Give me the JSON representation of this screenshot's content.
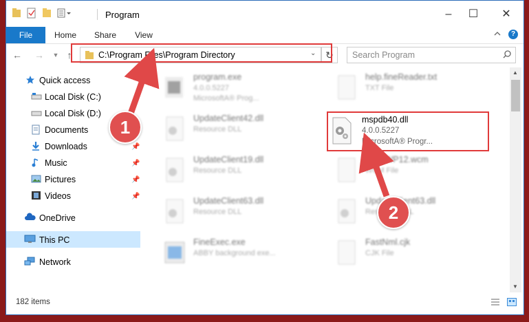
{
  "window": {
    "title": "Program"
  },
  "ribbon": {
    "tabs": [
      "File",
      "Home",
      "Share",
      "View"
    ],
    "help": "?"
  },
  "nav": {
    "path": "C:\\Program Files\\Program Directory",
    "search_placeholder": "Search Program"
  },
  "sidebar": {
    "items": [
      {
        "label": "Quick access",
        "icon": "star-icon"
      },
      {
        "label": "Local Disk (C:)",
        "icon": "drive-icon"
      },
      {
        "label": "Local Disk (D:)",
        "icon": "drive-icon"
      },
      {
        "label": "Documents",
        "icon": "documents-icon"
      },
      {
        "label": "Downloads",
        "icon": "download-icon"
      },
      {
        "label": "Music",
        "icon": "music-icon"
      },
      {
        "label": "Pictures",
        "icon": "pictures-icon"
      },
      {
        "label": "Videos",
        "icon": "videos-icon"
      },
      {
        "label": "OneDrive",
        "icon": "cloud-icon"
      },
      {
        "label": "This PC",
        "icon": "computer-icon"
      },
      {
        "label": "Network",
        "icon": "network-icon"
      }
    ]
  },
  "files": [
    {
      "name": "program.exe",
      "line2": "4.0.0.5227",
      "line3": "MicrosoftA® Prog...",
      "icon": "exe-icon"
    },
    {
      "name": "help.fineReader.txt",
      "line2": "TXT File",
      "line3": "",
      "icon": "txt-icon"
    },
    {
      "name": "UpdateClient42.dll",
      "line2": "Resource DLL",
      "line3": "",
      "icon": "dll-icon"
    },
    {
      "name": "mspdb40.dll",
      "line2": "4.0.0.5227",
      "line3": "MicrosoftA® Progr...",
      "icon": "dll-icon"
    },
    {
      "name": "UpdateClient19.dll",
      "line2": "Resource DLL",
      "line3": "",
      "icon": "dll-icon"
    },
    {
      "name": "ScanWP12.wcm",
      "line2": "WCM File",
      "line3": "",
      "icon": "file-icon"
    },
    {
      "name": "UpdateClient63.dll",
      "line2": "Resource DLL",
      "line3": "",
      "icon": "dll-icon"
    },
    {
      "name": "UpdateClient63.dll",
      "line2": "Resource DLL",
      "line3": "",
      "icon": "dll-icon"
    },
    {
      "name": "FineExec.exe",
      "line2": "ABBY background exe...",
      "line3": "",
      "icon": "exe-icon"
    },
    {
      "name": "FastNml.cjk",
      "line2": "CJK File",
      "line3": "",
      "icon": "file-icon"
    }
  ],
  "status": {
    "count": "182 items"
  },
  "annotations": {
    "step1": "1",
    "step2": "2"
  },
  "colors": {
    "accent": "#1979ca",
    "highlight": "#e03a3a",
    "selected": "#cce8ff"
  }
}
